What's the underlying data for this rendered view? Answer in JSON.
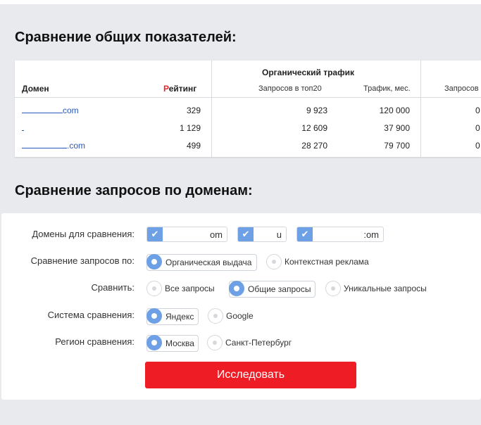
{
  "sections": {
    "overview_title": "Сравнение общих показателей:",
    "queries_title": "Сравнение запросов по доменам:"
  },
  "table": {
    "col_domain": "Домен",
    "col_rating_first": "Р",
    "col_rating_rest": "ейтинг",
    "group_organic": "Органический трафик",
    "col_queries_top20": "Запросов в топ20",
    "col_traffic": "Трафик, мес.",
    "col_queries_paid": "Запросов",
    "rows": [
      {
        "domain_prefix": "",
        "domain_suffix": "com",
        "rating": "329",
        "queries": "9 923",
        "traffic": "120 000",
        "paid": "0"
      },
      {
        "domain_prefix": "",
        "domain_suffix": "",
        "rating": "1 129",
        "queries": "12 609",
        "traffic": "37 900",
        "paid": "0"
      },
      {
        "domain_prefix": "",
        "domain_suffix": ".com",
        "rating": "499",
        "queries": "28 270",
        "traffic": "79 700",
        "paid": "0"
      }
    ]
  },
  "form": {
    "domains_label": "Домены для сравнения:",
    "domains": [
      "om",
      "u",
      ":om"
    ],
    "compare_by_label": "Сравнение запросов по:",
    "compare_by_options": [
      "Органическая выдача",
      "Контекстная реклама"
    ],
    "compare_label": "Сравнить:",
    "compare_options": [
      "Все запросы",
      "Общие запросы",
      "Уникальные запросы"
    ],
    "system_label": "Система сравнения:",
    "system_options": [
      "Яндекс",
      "Google"
    ],
    "region_label": "Регион сравнения:",
    "region_options": [
      "Москва",
      "Санкт-Петербург"
    ],
    "submit_label": "Исследовать"
  },
  "colors": {
    "accent_blue": "#6ea0e6",
    "button_red": "#ee1c25",
    "link_blue": "#2a57b7"
  }
}
